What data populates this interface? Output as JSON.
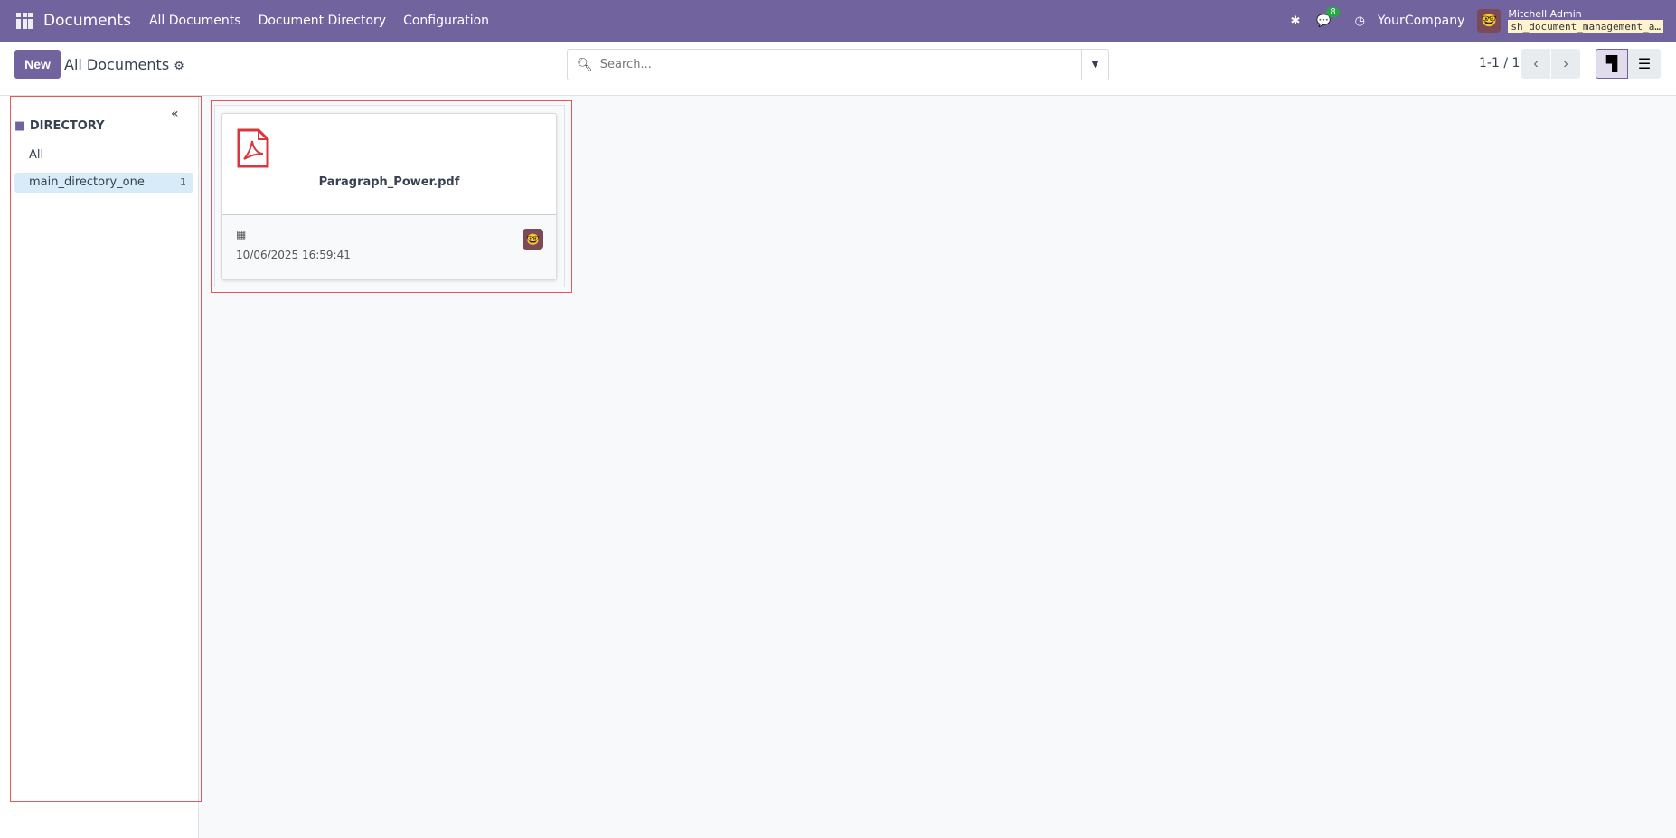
{
  "nav": {
    "app": "Documents",
    "menus": [
      "All Documents",
      "Document Directory",
      "Configuration"
    ],
    "messages_count": "8",
    "company": "YourCompany",
    "user": "Mitchell Admin",
    "database": "sh_document_management_a…"
  },
  "toolbar": {
    "new_label": "New",
    "title": "All Documents",
    "search_placeholder": "Search...",
    "pager": "1-1 / 1"
  },
  "sidebar": {
    "heading": "DIRECTORY",
    "items": [
      {
        "label": "All",
        "count": ""
      },
      {
        "label": "main_directory_one",
        "count": "1"
      }
    ]
  },
  "documents": [
    {
      "name": "Paragraph_Power.pdf",
      "date": "10/06/2025 16:59:41"
    }
  ],
  "colors": {
    "brand": "#71639e",
    "pdf": "#d9363e"
  }
}
